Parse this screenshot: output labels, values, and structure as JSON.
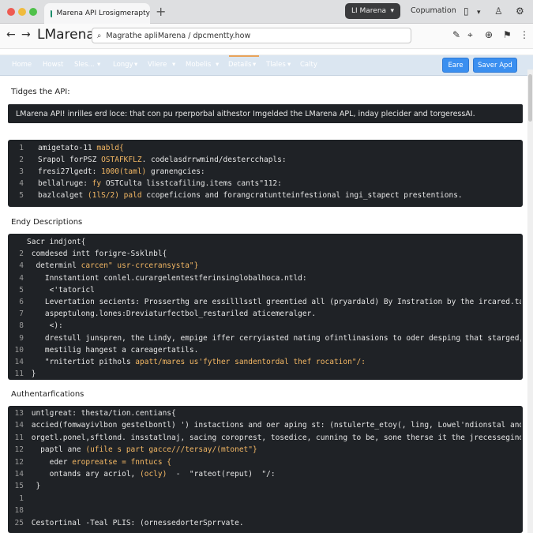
{
  "browser": {
    "tab_title": "Marena API Lrosigmerapty",
    "tab2_label": "LI Marena",
    "caption": "Copumation",
    "url": "Magrathe apliMarena / dpcmentty.how",
    "brand": "LMarena"
  },
  "menu": {
    "items": [
      "Home",
      "Howst",
      "Sles...",
      "Longy",
      "Vliere",
      "Mobelis",
      "Details",
      "Tlales",
      "Calty"
    ],
    "edit_label": "Eare",
    "save_label": "Saver Apd"
  },
  "sections": {
    "s1_heading": "Tidges the API:",
    "note": "LMarena API! inrilles erd loce: that con pu rperporbal aithestor Imgelded the LMarena APL, inday plecider and torgeressAI.",
    "s2_heading": "Endy Descriptions",
    "s3_heading": "Authentarfications"
  },
  "block1": {
    "lines": [
      {
        "n": "1",
        "pre": "amigetato-11 ",
        "hl": "mabld{",
        "post": ""
      },
      {
        "n": "2",
        "pre": "Srapol forPSZ ",
        "hl": "OSTAFKFLZ",
        "post": ". codelasdrrwmind/destercchapls:"
      },
      {
        "n": "3",
        "pre": "fresi27lgedt: ",
        "hl": "1000(taml)",
        "post": " granengcies:"
      },
      {
        "n": "4",
        "pre": "bellalruge: ",
        "hl": "fy",
        "post": " OSTCulta lisstcafiling.items cants\"112:"
      },
      {
        "n": "5",
        "pre": "bazlcalget ",
        "hl": "(1lS/2) pald",
        "post": " ccopeficions and forangcratuntteinfestional ingi_stapect prestentions."
      }
    ]
  },
  "block2": {
    "lines": [
      {
        "n": "",
        "pre": "Sacr indjont{",
        "hl": "",
        "post": ""
      },
      {
        "n": "2",
        "pre": " comdesed intt forigre-Ssklnbl{",
        "hl": "",
        "post": ""
      },
      {
        "n": "4",
        "pre": "  determinl ",
        "hl": "carcen\" usr-crceransysta\"}",
        "post": ""
      },
      {
        "n": "4",
        "pre": "    Innstantiont conlel.curargelentestferinsinglobalhoca.ntld:",
        "hl": "",
        "post": ""
      },
      {
        "n": "5",
        "pre": "     <'tatoricl",
        "hl": "",
        "post": ""
      },
      {
        "n": "6",
        "pre": "    Levertation secients: Prosserthg are essilllsstl greentied all (pryardald) By Instration by the ircared.tatectiors",
        "hl": "",
        "post": ""
      },
      {
        "n": "7",
        "pre": "    aspeptulong.lones:Dreviaturfectbol_restariled aticemeralger.",
        "hl": "",
        "post": ""
      },
      {
        "n": "8",
        "pre": "     <):",
        "hl": "",
        "post": ""
      },
      {
        "n": "9",
        "pre": "    drestull junspren, the Lindy, empige iffer cerryiasted nating ofintlinasions to oder desping that starged, on",
        "hl": "",
        "post": ""
      },
      {
        "n": "10",
        "pre": "    mestilig hangest a careagertatils.",
        "hl": "",
        "post": ""
      },
      {
        "n": "14",
        "pre": "    \"rnitertiot pithols ",
        "hl": "apatt/mares us'fyther sandentordal thef rocation\"/:",
        "post": ""
      },
      {
        "n": "11",
        "pre": " }",
        "hl": "",
        "post": ""
      }
    ]
  },
  "block3": {
    "lines": [
      {
        "n": "13",
        "pre": " untlgreat: thesta/tion.centians{",
        "hl": "",
        "post": ""
      },
      {
        "n": "14",
        "pre": " accied(fomwayivlbon gestelbontl) ') instactions and oer aping st: (nstulerte_etoy(, ling, Lowel'ndionstal and",
        "hl": "",
        "post": ""
      },
      {
        "n": "11",
        "pre": " orgetl.ponel,sftlond. insstatlnaj, sacing coroprest, tosedice, cunning to be, sone therse it the jrecessegindetsige:",
        "hl": "",
        "post": ""
      },
      {
        "n": "12",
        "pre": "   paptl ane ",
        "hl": "(ufile s part gacce///tersay/(mtonet\"}",
        "post": ""
      },
      {
        "n": "12",
        "pre": "     eder ",
        "hl": "eropreatse = fnntucs {",
        "post": ""
      },
      {
        "n": "14",
        "pre": "     ontands ary acriol, ",
        "hl": "(ocly)",
        "post": "  -  \"rateot(reput)  \"/:"
      },
      {
        "n": "15",
        "pre": "  }",
        "hl": "",
        "post": ""
      },
      {
        "n": "1",
        "pre": "",
        "hl": "",
        "post": ""
      },
      {
        "n": "18",
        "pre": "",
        "hl": "",
        "post": ""
      },
      {
        "n": "25",
        "pre": " Cestortinal -Teal PLIS: (ornessedorterSprrvate.",
        "hl": "",
        "post": ""
      }
    ]
  }
}
